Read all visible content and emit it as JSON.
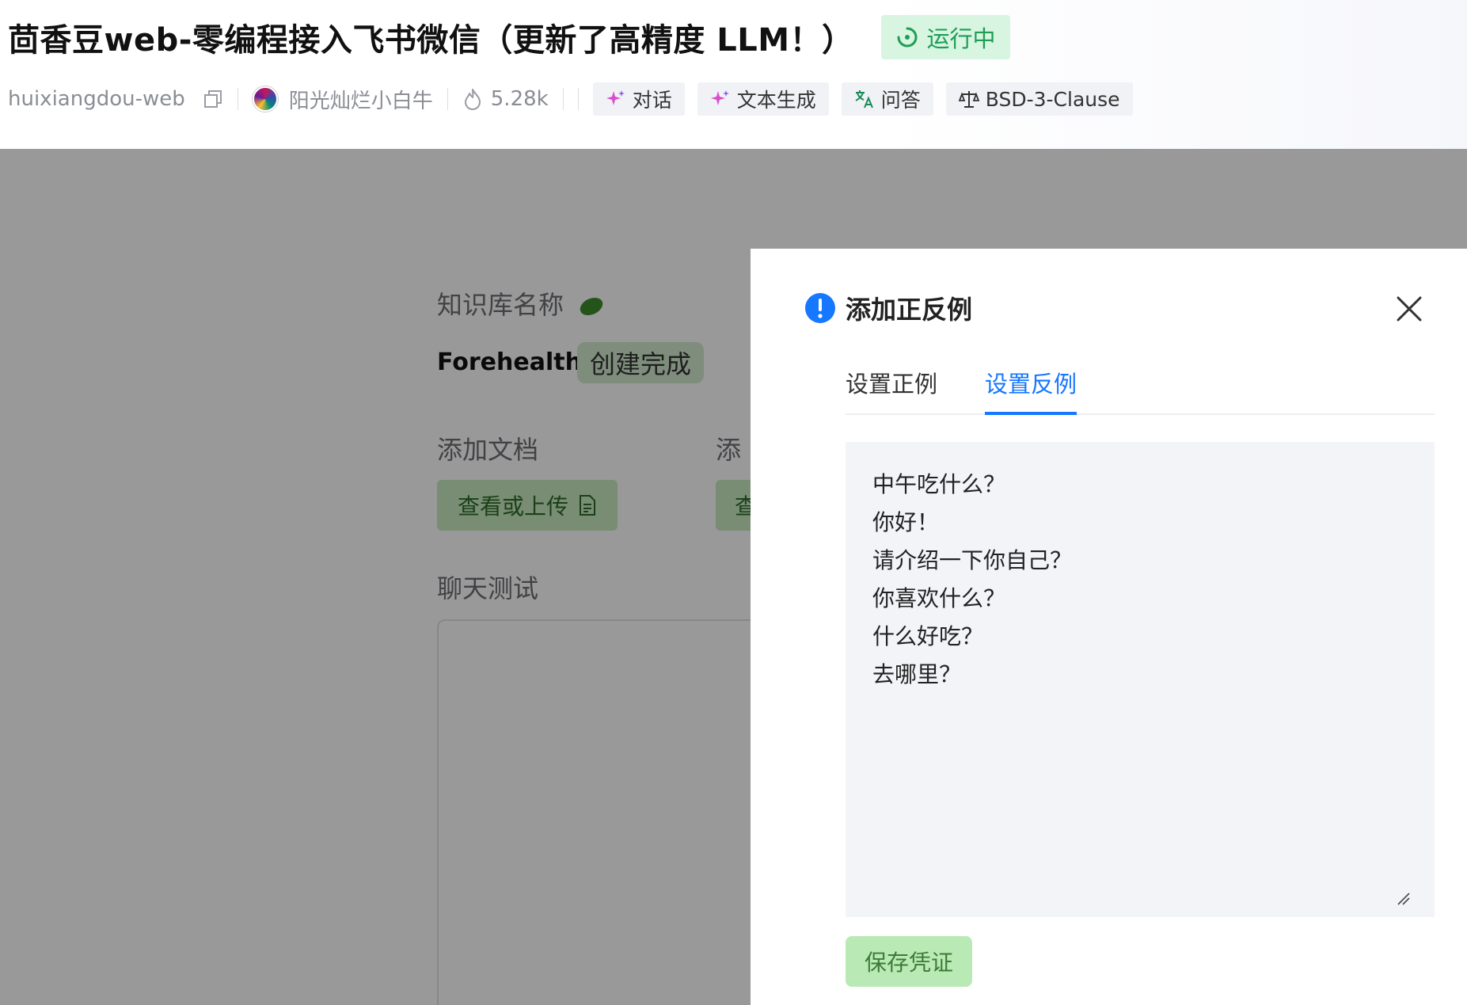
{
  "header": {
    "title": "茴香豆web-零编程接入飞书微信（更新了高精度 LLM！）",
    "status": "运行中",
    "repo": "huixiangdou-web",
    "author": "阳光灿烂小白牛",
    "heat": "5.28k",
    "tags": [
      {
        "label": "对话",
        "icon": "sparkle-icon"
      },
      {
        "label": "文本生成",
        "icon": "sparkle-icon"
      },
      {
        "label": "问答",
        "icon": "translate-icon"
      },
      {
        "label": "BSD-3-Clause",
        "icon": "scale-icon"
      }
    ]
  },
  "page": {
    "kb_label": "知识库名称",
    "kb_name": "Forehealth",
    "kb_status": "创建完成",
    "add_docs_label": "添加文档",
    "add_other_label": "添",
    "upload_button": "查看或上传",
    "upload_button_2": "查",
    "chat_test_label": "聊天测试"
  },
  "drawer": {
    "title": "添加正反例",
    "tabs": [
      {
        "label": "设置正例",
        "active": false
      },
      {
        "label": "设置反例",
        "active": true
      }
    ],
    "lines": [
      "中午吃什么？",
      "你好！",
      "请介绍一下你自己？",
      "你喜欢什么？",
      "什么好吃？",
      "去哪里？"
    ],
    "save_button": "保存凭证"
  },
  "colors": {
    "accent_blue": "#1677ff",
    "status_green": "#1f9d55",
    "button_green": "#b9eab5"
  }
}
